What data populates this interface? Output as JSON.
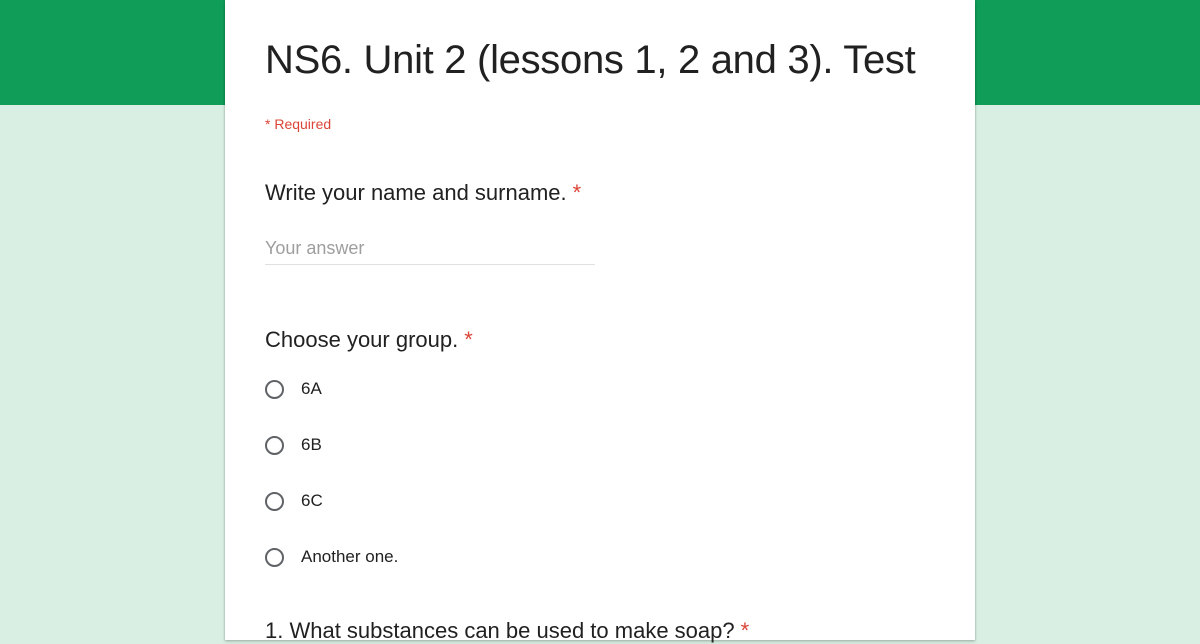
{
  "form": {
    "title": "NS6. Unit 2 (lessons 1, 2 and 3). Test",
    "required_note": "* Required",
    "colors": {
      "banner": "#109d58",
      "background": "#d9efe3",
      "required": "#db4437"
    }
  },
  "questions": [
    {
      "label": "Write your name and surname.",
      "required_mark": "*",
      "type": "short-answer",
      "value": "",
      "placeholder": "Your answer"
    },
    {
      "label": "Choose your group.",
      "required_mark": "*",
      "type": "radio",
      "options": [
        "6A",
        "6B",
        "6C",
        "Another one."
      ]
    },
    {
      "label": "1. What substances can be used to make soap?",
      "required_mark": "*",
      "partially_visible": true
    }
  ]
}
